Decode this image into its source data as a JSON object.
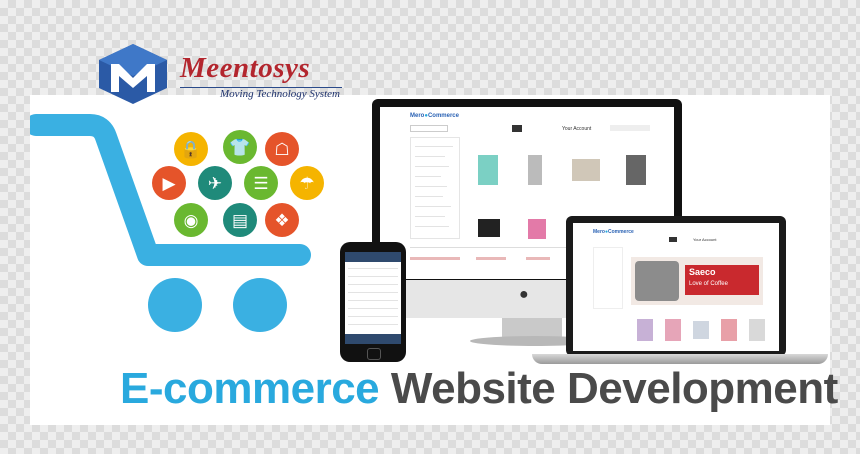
{
  "brand": {
    "name": "Meentosys",
    "tagline": "Moving Technology System",
    "colors": {
      "red": "#b3262e",
      "navy": "#1b2f6b",
      "logo_blue": "#2b5aa6"
    }
  },
  "headline": {
    "part1": "E-commerce",
    "part2": "Website Development",
    "color1": "#29a9de",
    "color2": "#4a4a4a"
  },
  "cart": {
    "color": "#3ab0e2"
  },
  "icon_bubbles": [
    {
      "icon": "lock-icon",
      "color": "#f5b400"
    },
    {
      "icon": "tshirt-icon",
      "color": "#6ab830"
    },
    {
      "icon": "store-icon",
      "color": "#e5542a"
    },
    {
      "icon": "mp3-player-icon",
      "color": "#e5542a"
    },
    {
      "icon": "airplane-icon",
      "color": "#1f8a7a"
    },
    {
      "icon": "books-icon",
      "color": "#6ab830"
    },
    {
      "icon": "umbrella-icon",
      "color": "#f5b400"
    },
    {
      "icon": "camera-icon",
      "color": "#6ab830"
    },
    {
      "icon": "document-icon",
      "color": "#1f8a7a"
    },
    {
      "icon": "puzzle-icon",
      "color": "#e5542a"
    }
  ],
  "monitor_site": {
    "logo_left": "Mero",
    "logo_right": "Commerce",
    "nav_label": "Your Account"
  },
  "laptop_site": {
    "logo_left": "Mero",
    "logo_right": "Commerce",
    "nav_label": "Your Account",
    "banner_brand": "Saeco",
    "banner_tag": "Love of Coffee"
  }
}
